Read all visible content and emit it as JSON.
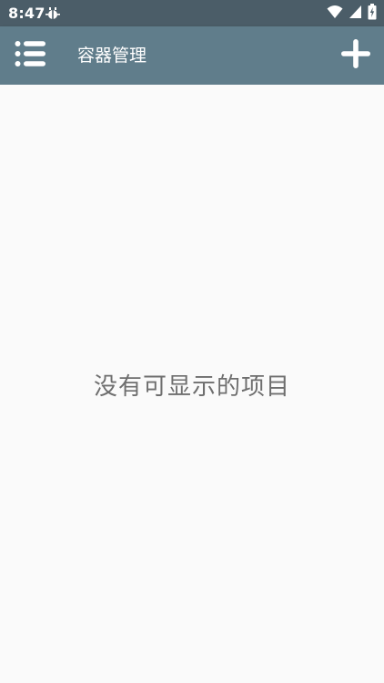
{
  "status_bar": {
    "time": "8:47",
    "icons": [
      "bug-notification-icon",
      "wifi-icon",
      "cellular-signal-icon",
      "battery-charging-icon"
    ]
  },
  "app_bar": {
    "title": "容器管理",
    "menu_icon": "list-menu-icon",
    "add_icon": "plus-icon"
  },
  "main": {
    "empty_message": "没有可显示的项目"
  },
  "colors": {
    "status_bar": "#4b5d68",
    "app_bar": "#607d8b",
    "background": "#fafafa",
    "empty_text": "#6e6e6e"
  }
}
